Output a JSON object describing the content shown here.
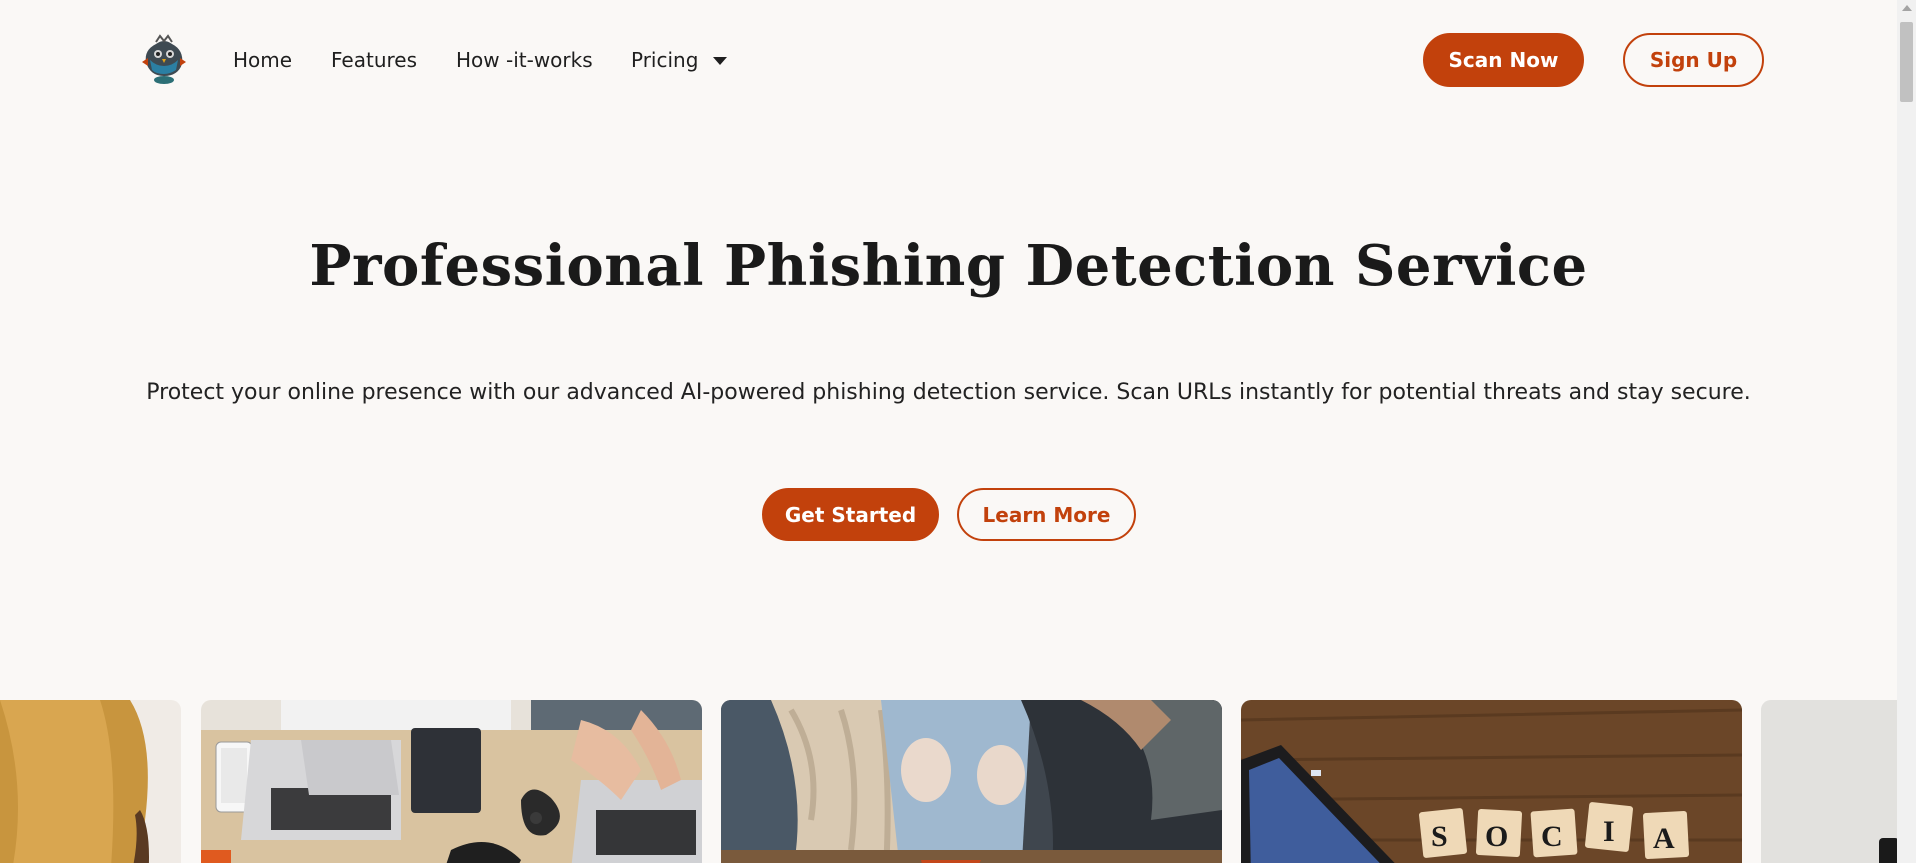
{
  "nav": {
    "logo_icon": "armored-bird-mascot-icon",
    "links": [
      "Home",
      "Features",
      "How -it-works",
      "Pricing"
    ],
    "pricing_caret_icon": "caret-down-icon",
    "scan_label": "Scan Now",
    "signup_label": "Sign Up"
  },
  "hero": {
    "title": "Professional Phishing Detection Service",
    "subtitle": "Protect your online presence with our advanced AI-powered phishing detection service. Scan URLs instantly for potential threats and stay secure.",
    "primary_label": "Get Started",
    "secondary_label": "Learn More"
  },
  "gallery": {
    "images": [
      "person-in-mustard-sweater-image",
      "laptops-on-desk-image",
      "ripped-jeans-people-image",
      "social-scrabble-tiles-phone-image",
      "partial-light-image"
    ],
    "tiles_text": "SOCIA"
  },
  "colors": {
    "accent": "#c2410c",
    "background": "#faf8f6",
    "text": "#1c1c1c"
  }
}
